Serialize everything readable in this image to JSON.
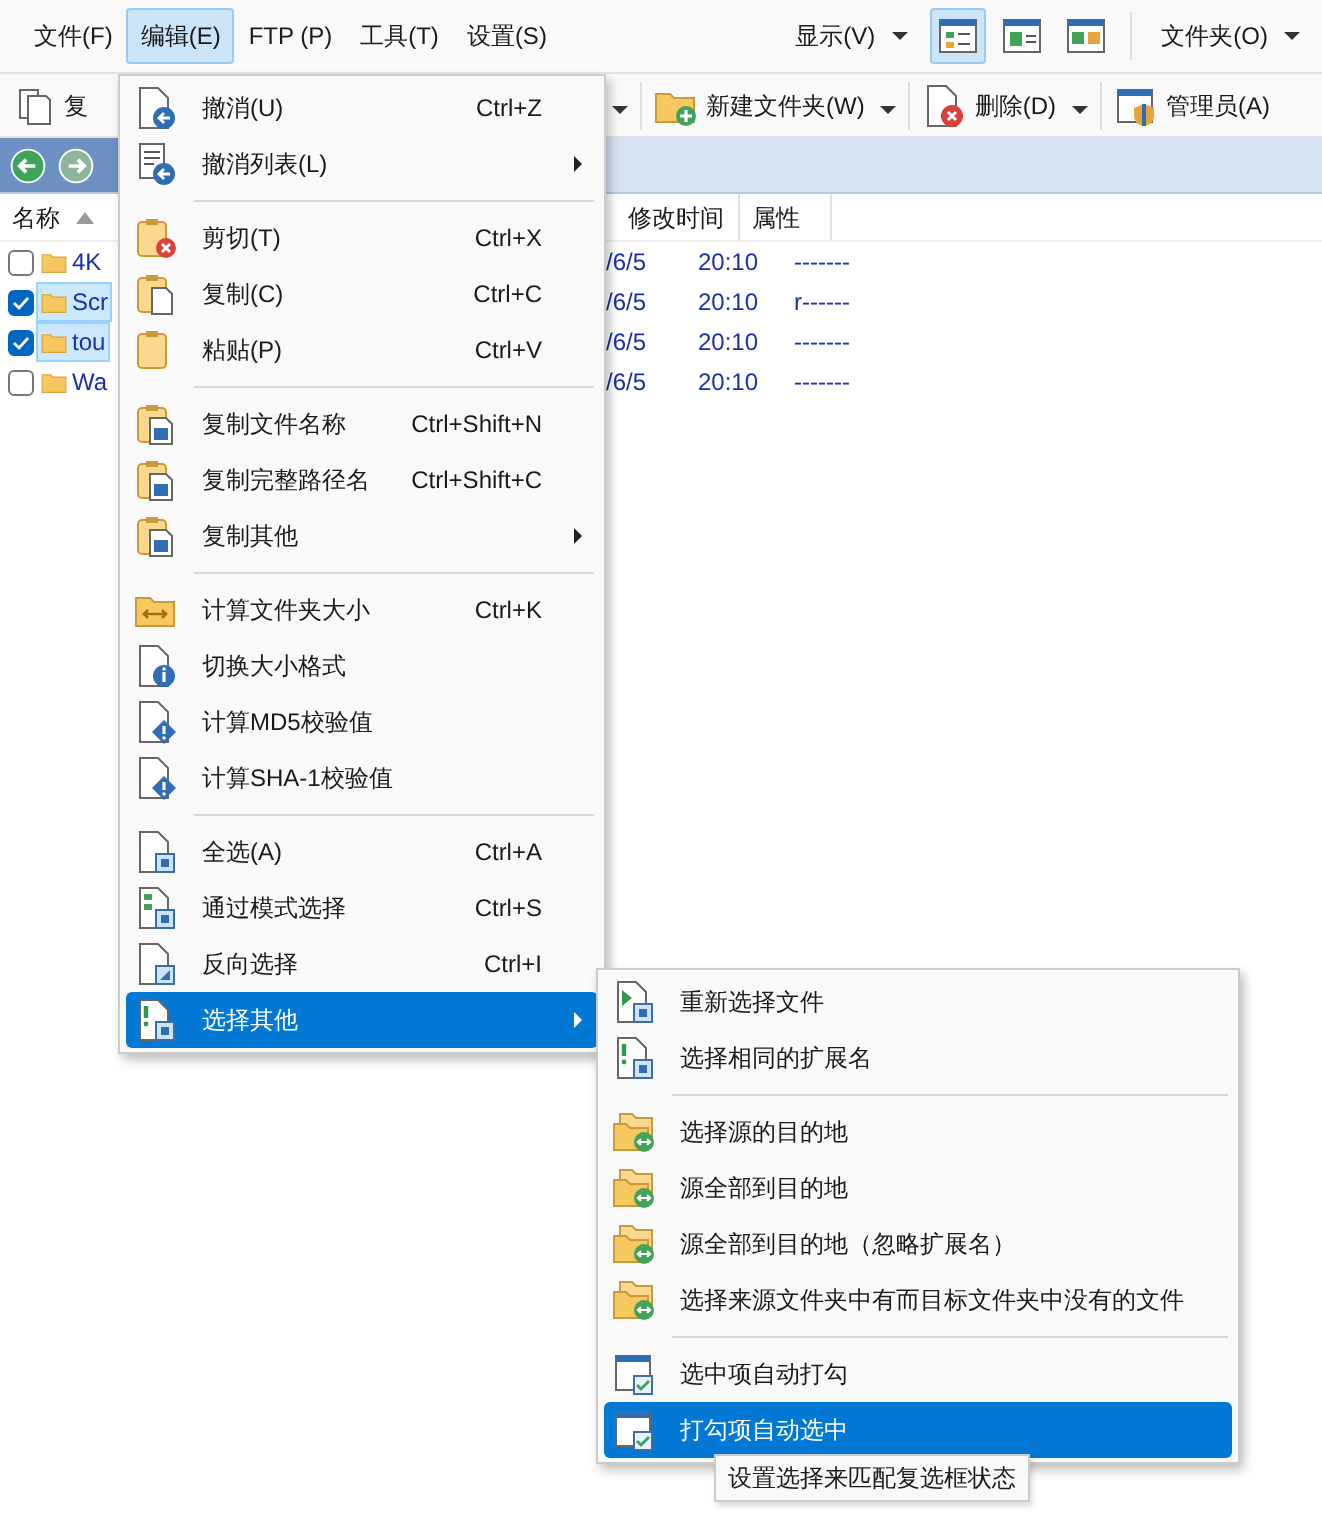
{
  "menubar": [
    {
      "label": "文件(F)",
      "selected": false
    },
    {
      "label": "编辑(E)",
      "selected": true
    },
    {
      "label": "FTP (P)",
      "selected": false
    },
    {
      "label": "工具(T)",
      "selected": false
    },
    {
      "label": "设置(S)",
      "selected": false
    }
  ],
  "display_menu": {
    "label": "显示(V)"
  },
  "view_buttons": [
    {
      "selected": true
    },
    {
      "selected": false
    },
    {
      "selected": false
    }
  ],
  "folder_menu": {
    "label": "文件夹(O)"
  },
  "toolbar": [
    {
      "label": "复",
      "dropdown": false
    },
    {
      "label": "新建文件夹(W)",
      "dropdown": true
    },
    {
      "label": "删除(D)",
      "dropdown": true
    },
    {
      "label": "管理员(A)",
      "dropdown": false
    }
  ],
  "file_list": {
    "columns": [
      "名称",
      "修改时间",
      "属性"
    ],
    "rows": [
      {
        "name": "4K",
        "checked": false,
        "selected": false,
        "date": "/6/5",
        "time": "20:10",
        "attributes": "-------"
      },
      {
        "name": "Scr",
        "checked": true,
        "selected": true,
        "date": "/6/5",
        "time": "20:10",
        "attributes": "r------"
      },
      {
        "name": "tou",
        "checked": true,
        "selected": true,
        "date": "/6/5",
        "time": "20:10",
        "attributes": "-------"
      },
      {
        "name": "Wa",
        "checked": false,
        "selected": false,
        "date": "/6/5",
        "time": "20:10",
        "attributes": "-------"
      }
    ]
  },
  "edit_menu": [
    {
      "kind": "item",
      "label": "撤消(U)",
      "shortcut": "Ctrl+Z",
      "submenu": false,
      "selected": false
    },
    {
      "kind": "item",
      "label": "撤消列表(L)",
      "submenu": true,
      "selected": false
    },
    {
      "kind": "separator"
    },
    {
      "kind": "item",
      "label": "剪切(T)",
      "shortcut": "Ctrl+X",
      "submenu": false,
      "selected": false
    },
    {
      "kind": "item",
      "label": "复制(C)",
      "shortcut": "Ctrl+C",
      "submenu": false,
      "selected": false
    },
    {
      "kind": "item",
      "label": "粘贴(P)",
      "shortcut": "Ctrl+V",
      "submenu": false,
      "selected": false
    },
    {
      "kind": "separator"
    },
    {
      "kind": "item",
      "label": "复制文件名称",
      "shortcut": "Ctrl+Shift+N",
      "submenu": false,
      "selected": false
    },
    {
      "kind": "item",
      "label": "复制完整路径名",
      "shortcut": "Ctrl+Shift+C",
      "submenu": false,
      "selected": false
    },
    {
      "kind": "item",
      "label": "复制其他",
      "submenu": true,
      "selected": false
    },
    {
      "kind": "separator"
    },
    {
      "kind": "item",
      "label": "计算文件夹大小",
      "shortcut": "Ctrl+K",
      "submenu": false,
      "selected": false
    },
    {
      "kind": "item",
      "label": "切换大小格式",
      "submenu": false,
      "selected": false
    },
    {
      "kind": "item",
      "label": "计算MD5校验值",
      "submenu": false,
      "selected": false
    },
    {
      "kind": "item",
      "label": "计算SHA-1校验值",
      "submenu": false,
      "selected": false
    },
    {
      "kind": "separator"
    },
    {
      "kind": "item",
      "label": "全选(A)",
      "shortcut": "Ctrl+A",
      "submenu": false,
      "selected": false
    },
    {
      "kind": "item",
      "label": "通过模式选择",
      "shortcut": "Ctrl+S",
      "submenu": false,
      "selected": false
    },
    {
      "kind": "item",
      "label": "反向选择",
      "shortcut": "Ctrl+I",
      "submenu": false,
      "selected": false
    },
    {
      "kind": "item",
      "label": "选择其他",
      "submenu": true,
      "selected": true
    }
  ],
  "select_other_menu": [
    {
      "kind": "item",
      "label": "重新选择文件",
      "selected": false
    },
    {
      "kind": "item",
      "label": "选择相同的扩展名",
      "selected": false
    },
    {
      "kind": "separator"
    },
    {
      "kind": "item",
      "label": "选择源的目的地",
      "selected": false
    },
    {
      "kind": "item",
      "label": "源全部到目的地",
      "selected": false
    },
    {
      "kind": "item",
      "label": "源全部到目的地（忽略扩展名）",
      "selected": false
    },
    {
      "kind": "item",
      "label": "选择来源文件夹中有而目标文件夹中没有的文件",
      "selected": false
    },
    {
      "kind": "separator"
    },
    {
      "kind": "item",
      "label": "选中项自动打勾",
      "selected": false
    },
    {
      "kind": "item",
      "label": "打勾项自动选中",
      "selected": true
    }
  ],
  "tooltip": "设置选择来匹配复选框状态"
}
